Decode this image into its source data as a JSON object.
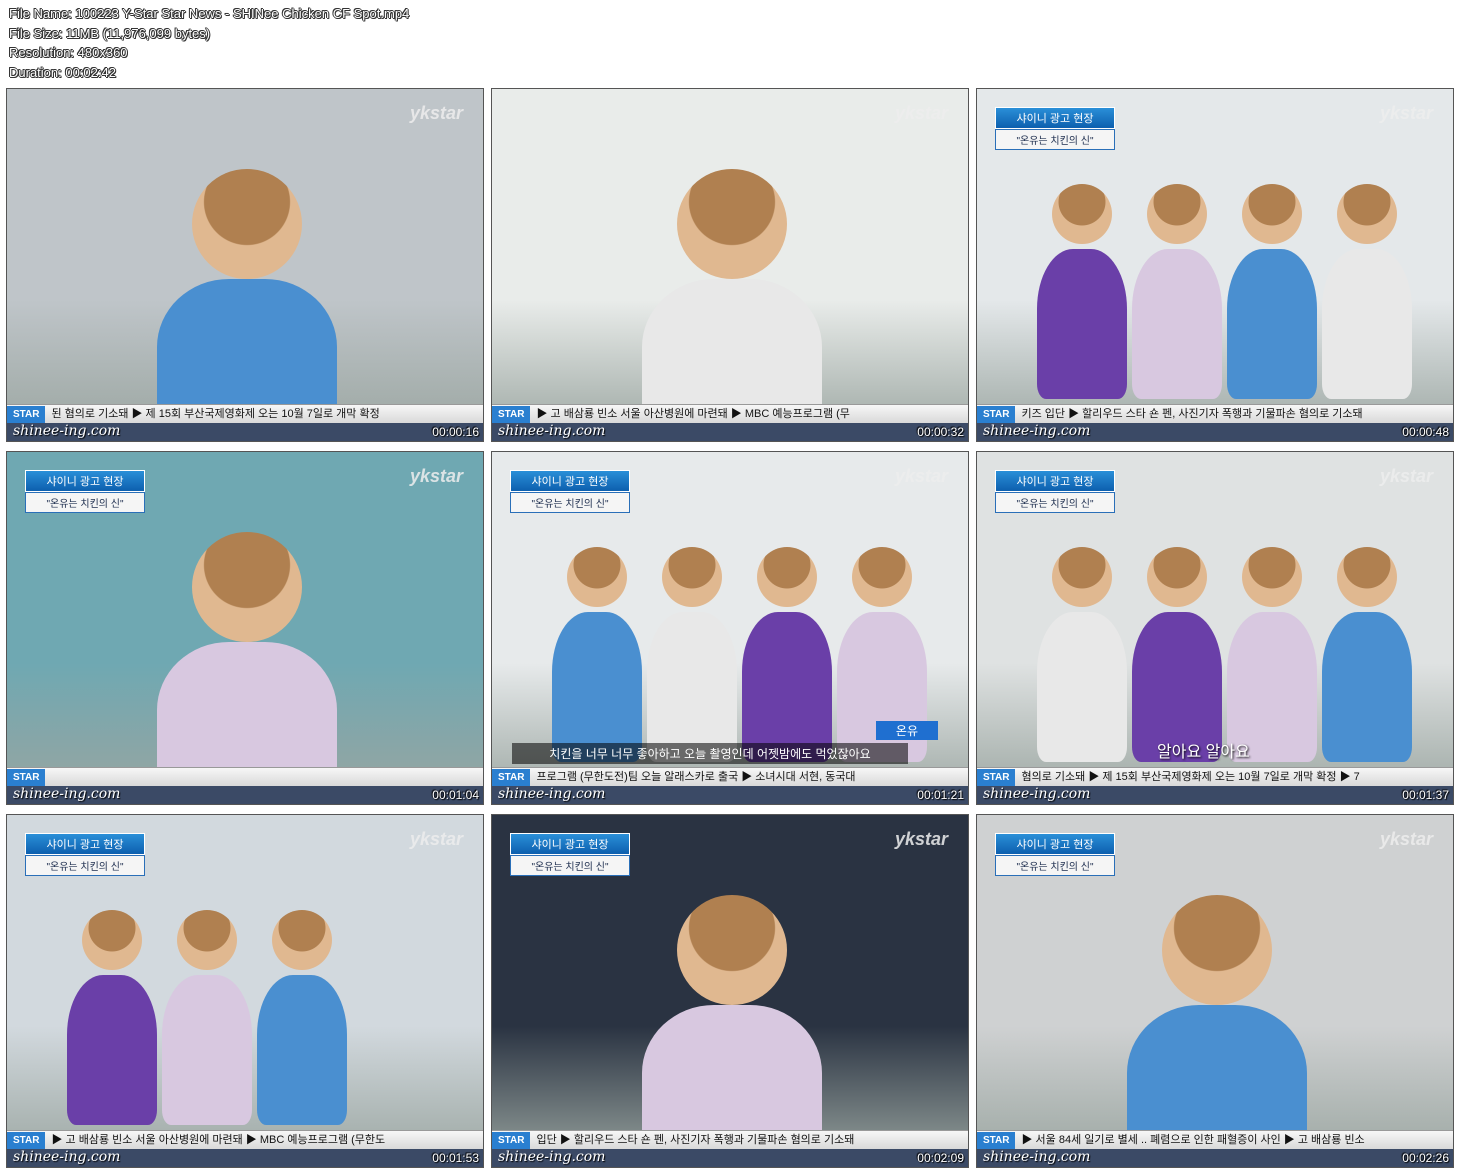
{
  "header": {
    "file_name": "File Name: 100223 Y-Star Star News - SHINee Chicken CF Spot.mp4",
    "file_size": "File Size: 11MB (11,976,099 bytes)",
    "resolution": "Resolution: 480x360",
    "duration": "Duration: 00:02:42"
  },
  "watermark": "shinee-ing.com",
  "logo_text": "ykstar",
  "caption": {
    "line1": "샤이니 광고 현장",
    "line2": "\"온유는 치킨의 신\""
  },
  "thumbnails": [
    {
      "timestamp": "00:00:16",
      "ticker": "된 혐의로 기소돼  ▶ 제 15회 부산국제영화제 오는 10월 7일로 개막 확정",
      "bg": "#bfc5c9",
      "caption": false,
      "subtitle": "",
      "name": ""
    },
    {
      "timestamp": "00:00:32",
      "ticker": "▶ 고 배삼룡 빈소 서울 아산병원에 마련돼  ▶ MBC 예능프로그램 (무",
      "bg": "#e9ecea",
      "caption": false,
      "subtitle": "",
      "name": ""
    },
    {
      "timestamp": "00:00:48",
      "ticker": "키즈 입단  ▶ 할리우드 스타 숀 펜, 사진기자 폭행과 기물파손 혐의로 기소돼",
      "bg": "#e4e8ea",
      "caption": true,
      "subtitle": "",
      "name": ""
    },
    {
      "timestamp": "00:01:04",
      "ticker": "",
      "bg": "#6fa8b2",
      "caption": true,
      "subtitle": "",
      "name": ""
    },
    {
      "timestamp": "00:01:21",
      "ticker": "프로그램 (무한도전)팀 오늘 알래스카로 출국  ▶ 소녀시대 서현, 동국대",
      "bg": "#e7eaeb",
      "caption": true,
      "subtitle": "치킨을 너무 너무 좋아하고 오늘 촬영인데 어젯밤에도 먹었잖아요",
      "name": "온유"
    },
    {
      "timestamp": "00:01:37",
      "ticker": "혐의로 기소돼  ▶ 제 15회 부산국제영화제 오는 10월 7일로 개막 확정  ▶ 7",
      "bg": "#dfe2e2",
      "caption": true,
      "subtitle": "알아요  알아요",
      "name": ""
    },
    {
      "timestamp": "00:01:53",
      "ticker": "▶ 고 배삼룡 빈소 서울 아산병원에 마련돼  ▶ MBC 예능프로그램 (무한도",
      "bg": "#d2d9de",
      "caption": true,
      "subtitle": "",
      "name": ""
    },
    {
      "timestamp": "00:02:09",
      "ticker": "입단  ▶ 할리우드 스타 숀 펜, 사진기자 폭행과 기물파손 혐의로 기소돼",
      "bg": "#2a3342",
      "caption": true,
      "subtitle": "",
      "name": ""
    },
    {
      "timestamp": "00:02:26",
      "ticker": "▶ 서울 84세 일기로 별세 .. 폐렴으로 인한 패혈증이 사인  ▶ 고 배삼룡 빈소",
      "bg": "#cfd1d2",
      "caption": true,
      "subtitle": "",
      "name": ""
    }
  ]
}
